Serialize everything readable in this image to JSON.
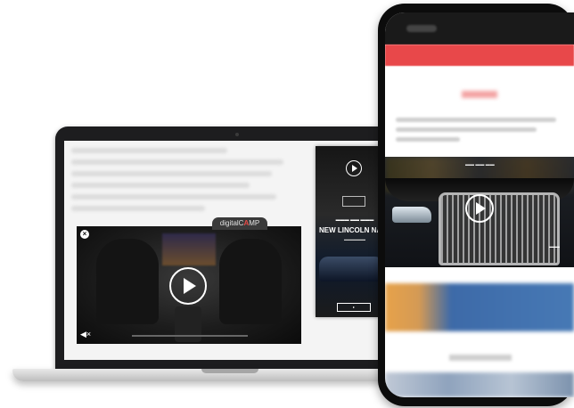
{
  "laptop": {
    "player": {
      "brand_prefix": "digital",
      "brand_mid": "C",
      "brand_accent": "A",
      "brand_suffix": "MP",
      "accent_color": "#e84b47",
      "close_icon": "close-icon",
      "mute_icon": "speaker-muted-icon",
      "play_icon": "play-icon"
    },
    "side_ad": {
      "headline": "NEW LINCOLN NAVIG",
      "play_icon": "play-icon"
    }
  },
  "phone": {
    "video_ad": {
      "play_icon": "play-icon"
    }
  }
}
